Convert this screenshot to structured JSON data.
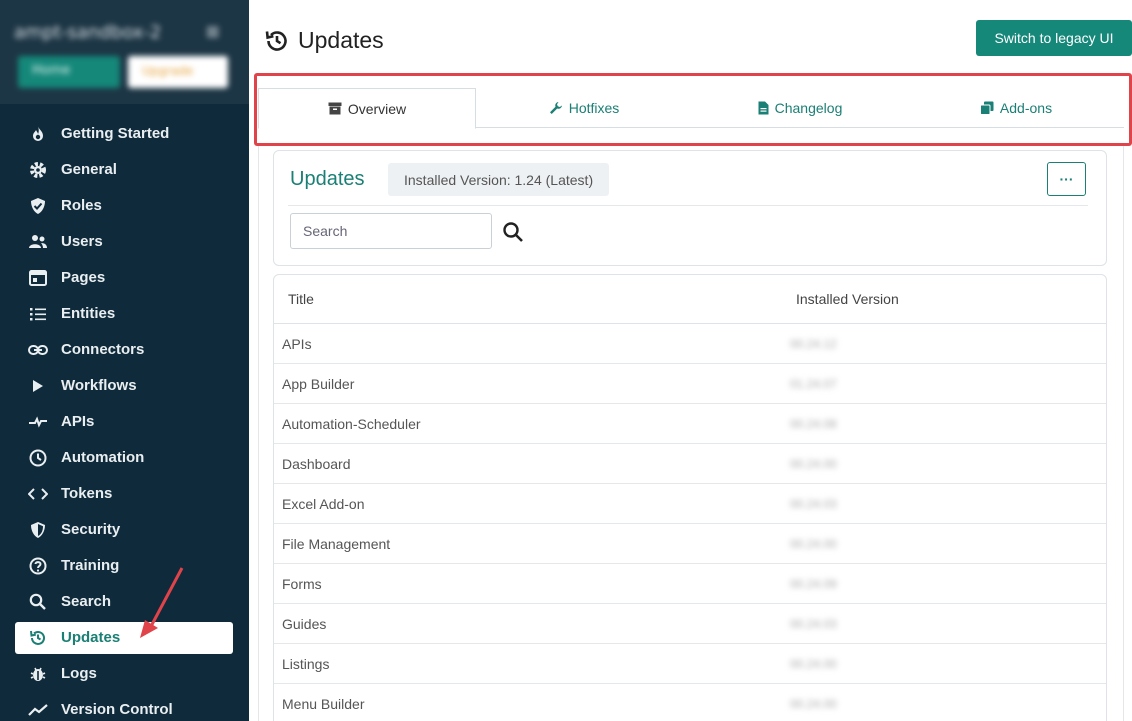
{
  "sidebar": {
    "org_name": "ampt-sandbox-2",
    "org_close": "⊠",
    "home_button": "Home",
    "orange_button": "Upgrade",
    "items": [
      {
        "label": "Getting Started",
        "icon": "flame-icon"
      },
      {
        "label": "General",
        "icon": "gear-icon"
      },
      {
        "label": "Roles",
        "icon": "shield-check-icon"
      },
      {
        "label": "Users",
        "icon": "users-icon"
      },
      {
        "label": "Pages",
        "icon": "window-icon"
      },
      {
        "label": "Entities",
        "icon": "list-icon"
      },
      {
        "label": "Connectors",
        "icon": "link-icon"
      },
      {
        "label": "Workflows",
        "icon": "play-icon"
      },
      {
        "label": "APIs",
        "icon": "api-icon"
      },
      {
        "label": "Automation",
        "icon": "clock-icon"
      },
      {
        "label": "Tokens",
        "icon": "code-icon"
      },
      {
        "label": "Security",
        "icon": "shield-half-icon"
      },
      {
        "label": "Training",
        "icon": "question-icon"
      },
      {
        "label": "Search",
        "icon": "search-icon"
      },
      {
        "label": "Updates",
        "icon": "history-icon",
        "active": true
      },
      {
        "label": "Logs",
        "icon": "bug-icon"
      },
      {
        "label": "Version Control",
        "icon": "chart-line-icon"
      }
    ]
  },
  "header": {
    "title": "Updates",
    "legacy_button": "Switch to legacy UI"
  },
  "tabs": [
    {
      "label": "Overview",
      "icon": "archive-icon",
      "active": true
    },
    {
      "label": "Hotfixes",
      "icon": "wrench-icon"
    },
    {
      "label": "Changelog",
      "icon": "file-icon"
    },
    {
      "label": "Add-ons",
      "icon": "copy-icon"
    }
  ],
  "card": {
    "title": "Updates",
    "installed_version": "Installed Version: 1.24 (Latest)",
    "more_label": "···",
    "search_placeholder": "Search"
  },
  "table": {
    "columns": [
      "Title",
      "Installed Version"
    ],
    "rows": [
      {
        "title": "APIs",
        "version": "00.24.12"
      },
      {
        "title": "App Builder",
        "version": "01.24.07"
      },
      {
        "title": "Automation-Scheduler",
        "version": "00.24.08"
      },
      {
        "title": "Dashboard",
        "version": "00.24.00"
      },
      {
        "title": "Excel Add-on",
        "version": "00.24.03"
      },
      {
        "title": "File Management",
        "version": "00.24.00"
      },
      {
        "title": "Forms",
        "version": "00.24.09"
      },
      {
        "title": "Guides",
        "version": "00.24.03"
      },
      {
        "title": "Listings",
        "version": "00.24.00"
      },
      {
        "title": "Menu Builder",
        "version": "00.24.00"
      }
    ]
  },
  "colors": {
    "sidebar_bg": "#0f2a3a",
    "accent": "#15887a",
    "highlight": "#e0434a",
    "arrow": "#e0434a"
  }
}
